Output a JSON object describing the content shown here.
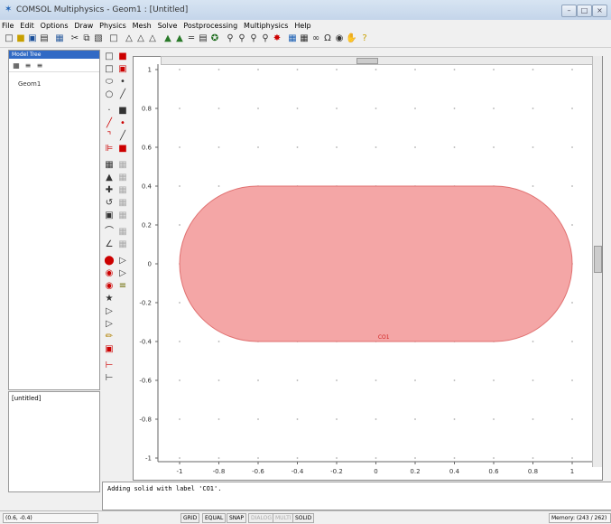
{
  "window": {
    "title": "COMSOL Multiphysics - Geom1 : [Untitled]"
  },
  "menu": [
    "File",
    "Edit",
    "Options",
    "Draw",
    "Physics",
    "Mesh",
    "Solve",
    "Postprocessing",
    "Multiphysics",
    "Help"
  ],
  "model_tree": {
    "header": "Model Tree",
    "item": "Geom1"
  },
  "lower_panel": {
    "label": "[untitled]"
  },
  "canvas": {
    "y_ticks": [
      "1",
      "0.8",
      "0.6",
      "0.4",
      "0.2",
      "0",
      "-0.2",
      "-0.4",
      "-0.6",
      "-0.8",
      "-1"
    ],
    "x_ticks": [
      "-1",
      "-0.8",
      "-0.6",
      "-0.4",
      "-0.2",
      "0",
      "0.2",
      "0.4",
      "0.6",
      "0.8",
      "1"
    ],
    "shape": {
      "label": "CO1",
      "x_min": -1.0,
      "x_max": 1.0,
      "y_min": -0.4,
      "y_max": 0.4,
      "fill": "#f4a6a6",
      "stroke": "#e07070"
    }
  },
  "log": {
    "message": "Adding solid with label 'CO1'."
  },
  "status": {
    "coords": "(0.6, -0.4)",
    "buttons": [
      "GRID",
      "EQUAL",
      "SNAP",
      "DIALOG",
      "MULTI",
      "SOLID"
    ],
    "disabled": [
      "DIALOG",
      "MULTI"
    ],
    "memory": "Memory: (243 / 262)"
  }
}
